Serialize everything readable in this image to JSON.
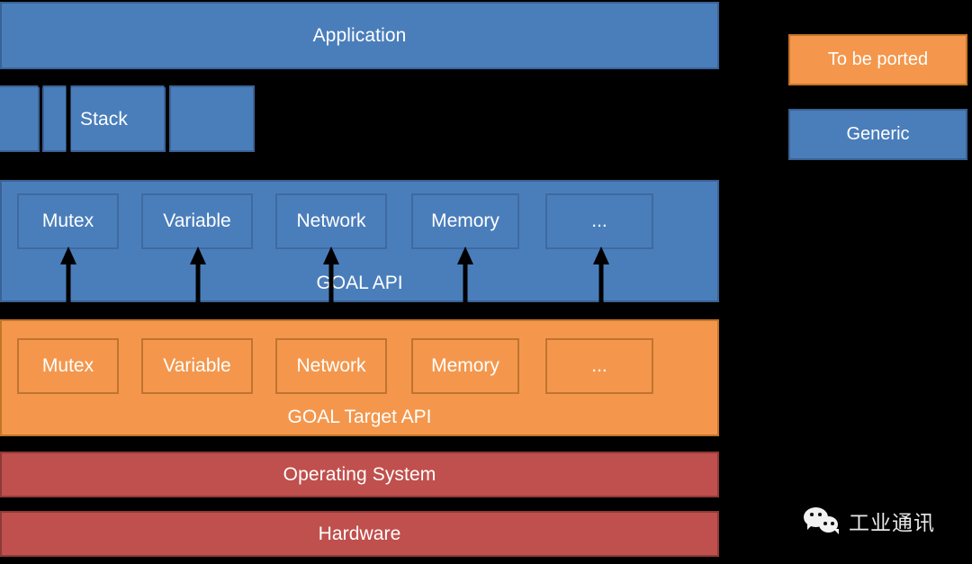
{
  "colors": {
    "background": "#000000",
    "generic_blue": "#4a7ebb",
    "to_be_ported_orange": "#f4974c",
    "system_red": "#c0504d",
    "text": "#ffffff"
  },
  "diagram": {
    "title_layer": {
      "label": "Application"
    },
    "stack_layer": {
      "boxes": [
        {
          "label": ""
        },
        {
          "label": "Stack"
        },
        {
          "label": ""
        }
      ]
    },
    "goal_api_band": {
      "caption": "GOAL API",
      "modules": [
        {
          "label": "Mutex"
        },
        {
          "label": "Variable"
        },
        {
          "label": "Network"
        },
        {
          "label": "Memory"
        },
        {
          "label": "..."
        }
      ]
    },
    "goal_target_api_band": {
      "caption": "GOAL Target API",
      "modules": [
        {
          "label": "Mutex"
        },
        {
          "label": "Variable"
        },
        {
          "label": "Network"
        },
        {
          "label": "Memory"
        },
        {
          "label": "..."
        }
      ]
    },
    "os_layer": {
      "label": "Operating System"
    },
    "hardware_layer": {
      "label": "Hardware"
    }
  },
  "legend": {
    "items": [
      {
        "label": "To be ported",
        "color": "#f4974c"
      },
      {
        "label": "Generic",
        "color": "#4a7ebb"
      }
    ]
  },
  "watermark": {
    "icon": "wechat-icon",
    "text": "工业通讯"
  }
}
